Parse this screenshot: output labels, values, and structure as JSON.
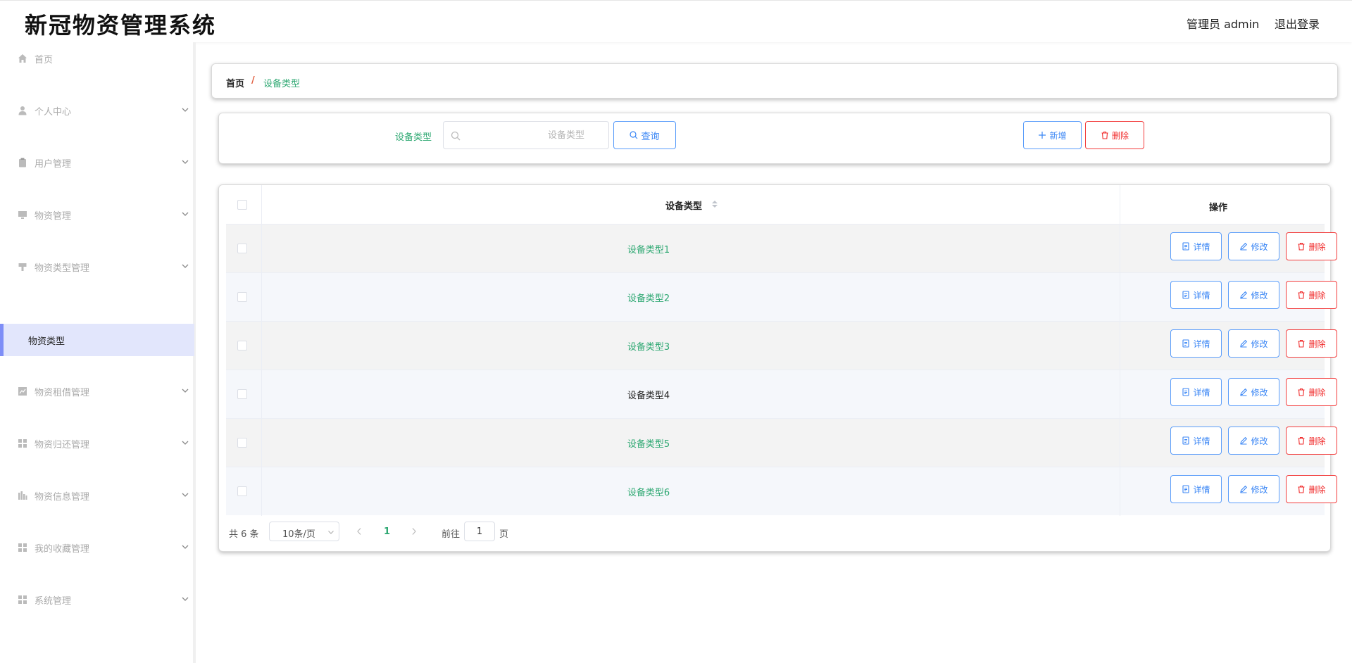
{
  "header": {
    "title": "新冠物资管理系统",
    "user_label": "管理员 admin",
    "logout_label": "退出登录"
  },
  "sidebar": {
    "items": [
      {
        "label": "首页",
        "icon": "home-icon"
      },
      {
        "label": "个人中心",
        "icon": "user-icon"
      },
      {
        "label": "用户管理",
        "icon": "clipboard-icon"
      },
      {
        "label": "物资管理",
        "icon": "monitor-icon"
      },
      {
        "label": "物资类型管理",
        "icon": "stamp-icon"
      },
      {
        "label": "物资租借管理",
        "icon": "chart-icon"
      },
      {
        "label": "物资归还管理",
        "icon": "grid-icon"
      },
      {
        "label": "物资信息管理",
        "icon": "bar-icon"
      },
      {
        "label": "我的收藏管理",
        "icon": "grid-icon"
      },
      {
        "label": "系统管理",
        "icon": "grid-icon"
      }
    ],
    "active_sub": "物资类型"
  },
  "breadcrumb": {
    "home": "首页",
    "separator": "/",
    "current": "设备类型"
  },
  "search": {
    "label": "设备类型",
    "placeholder": "设备类型",
    "query_label": "查询",
    "add_label": "新增",
    "delete_label": "删除"
  },
  "table": {
    "col_type": "设备类型",
    "col_op": "操作",
    "rows": [
      {
        "type": "设备类型1",
        "color": "#2ea872"
      },
      {
        "type": "设备类型2",
        "color": "#2ea872"
      },
      {
        "type": "设备类型3",
        "color": "#2ea872"
      },
      {
        "type": "设备类型4",
        "color": "#222222"
      },
      {
        "type": "设备类型5",
        "color": "#2ea872"
      },
      {
        "type": "设备类型6",
        "color": "#2ea872"
      }
    ],
    "detail_label": "详情",
    "edit_label": "修改",
    "delete_label": "删除"
  },
  "pagination": {
    "total": "共 6 条",
    "page_size": "10条/页",
    "current_page": "1",
    "goto_pre": "前往",
    "goto_value": "1",
    "goto_post": "页"
  },
  "colors": {
    "accent_green": "#2ea872",
    "primary_blue": "#3a86f5",
    "danger_red": "#f02929",
    "active_menu_bg": "#e2e6fc"
  }
}
